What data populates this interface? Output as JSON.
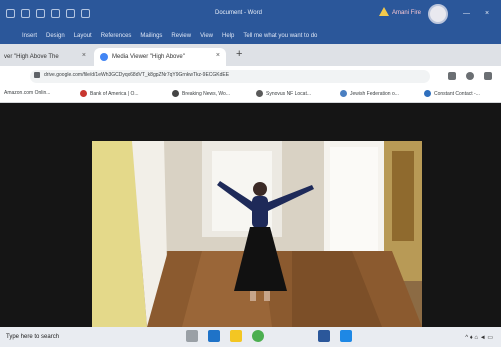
{
  "word": {
    "title": "Document - Word",
    "user_name": "Amani Fire",
    "ribbon_tabs": [
      "Insert",
      "Design",
      "Layout",
      "References",
      "Mailings",
      "Review",
      "View",
      "Help",
      "Tell me what you want to do"
    ],
    "controls": [
      "—",
      "×"
    ]
  },
  "browser": {
    "tabs": [
      {
        "title": "ver \"High Above The",
        "active": false
      },
      {
        "title": "Media Viewer \"High Above\"",
        "active": true
      }
    ],
    "new_tab": "+",
    "url": "drive.google.com/file/d/1eWh3GCDyqx68dVT_k8gpZNr7qY9GrnkwTkz-9ECGKdEE",
    "bookmarks": [
      "Amazon.com Onlin...",
      "Bank of America | O...",
      "Breaking News, Wo...",
      "Synovus NF Locat...",
      "Jewish Federation o...",
      "Constant Contact -..."
    ]
  },
  "taskbar": {
    "search_text": "Type here to search",
    "tray_text": "^ ♦ ⌂ ◄ ▭"
  },
  "colors": {
    "word_blue": "#2b579a",
    "chrome_tab_bg": "#dee1e6",
    "viewer_bg": "#151515"
  }
}
